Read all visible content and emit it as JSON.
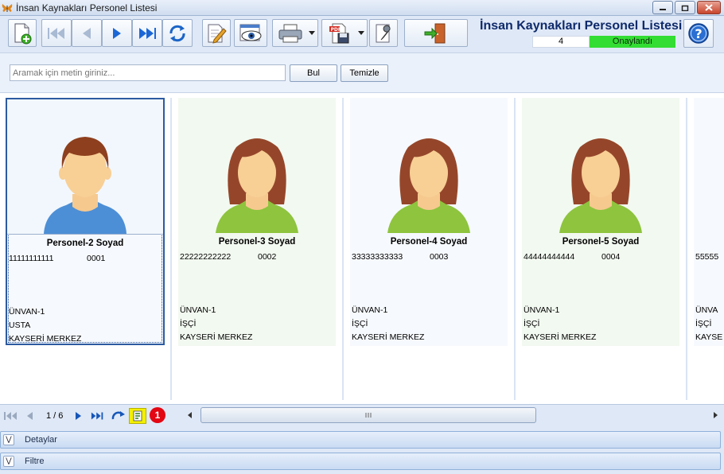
{
  "window": {
    "title": "İnsan Kaynakları Personel Listesi"
  },
  "header": {
    "title": "İnsan Kaynakları Personel Listesi",
    "count": "4",
    "status": "Onaylandı",
    "status_color": "#33dd33"
  },
  "toolbar": {
    "icons": [
      "new-record-icon",
      "first-record-icon",
      "previous-record-icon",
      "next-record-icon",
      "last-record-icon",
      "refresh-icon",
      "edit-icon",
      "preview-icon",
      "print-icon",
      "pdf-export-icon",
      "settings-wrench-icon",
      "exit-door-icon",
      "help-icon"
    ]
  },
  "search": {
    "placeholder": "Aramak için metin giriniz...",
    "find_label": "Bul",
    "clear_label": "Temizle"
  },
  "cards": [
    {
      "name": "Personel-2 Soyad",
      "tc": "11111111111",
      "number": "0001",
      "line1": "ÜNVAN-1",
      "line2": "USTA",
      "line3": "KAYSERİ MERKEZ",
      "avatar": "male-avatar",
      "selected": true
    },
    {
      "name": "Personel-3 Soyad",
      "tc": "22222222222",
      "number": "0002",
      "line1": "ÜNVAN-1",
      "line2": "İŞÇİ",
      "line3": "KAYSERİ MERKEZ",
      "avatar": "female-avatar",
      "selected": false
    },
    {
      "name": "Personel-4 Soyad",
      "tc": "33333333333",
      "number": "0003",
      "line1": "ÜNVAN-1",
      "line2": "İŞÇİ",
      "line3": "KAYSERİ MERKEZ",
      "avatar": "female-avatar",
      "selected": false
    },
    {
      "name": "Personel-5 Soyad",
      "tc": "44444444444",
      "number": "0004",
      "line1": "ÜNVAN-1",
      "line2": "İŞÇİ",
      "line3": "KAYSERİ MERKEZ",
      "avatar": "female-avatar",
      "selected": false
    },
    {
      "name": "",
      "tc": "55555",
      "number": "",
      "line1": "ÜNVA",
      "line2": "İŞÇİ",
      "line3": "KAYSE",
      "avatar": "",
      "selected": false
    }
  ],
  "navigator": {
    "page": "1 / 6",
    "badge": "1"
  },
  "panels": {
    "details": "Detaylar",
    "filter": "Filtre"
  }
}
